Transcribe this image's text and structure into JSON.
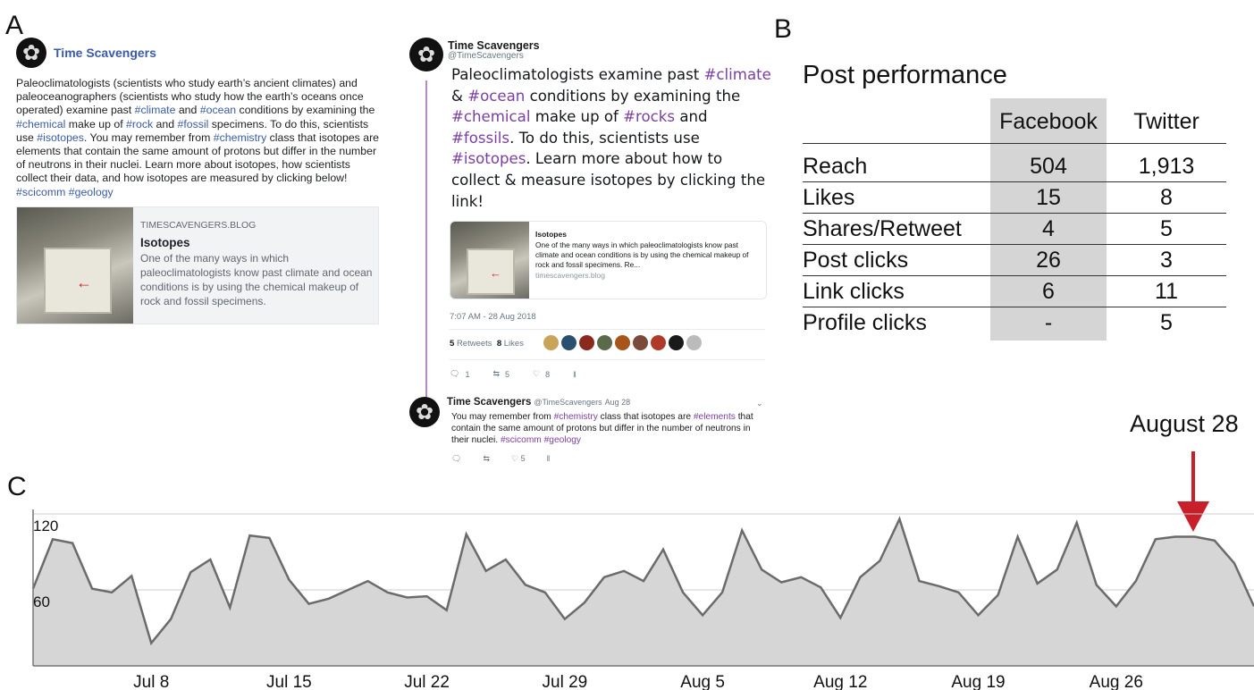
{
  "panel_labels": {
    "a": "A",
    "b": "B",
    "c": "C"
  },
  "facebook_post": {
    "page_name": "Time Scavengers",
    "text_parts": [
      {
        "t": "Paleoclimatologists (scientists who study earth’s ancient climates) and paleoceanographers (scientists who study how the earth’s oceans once operated) examine past ",
        "tag": false
      },
      {
        "t": "#climate",
        "tag": true
      },
      {
        "t": " and ",
        "tag": false
      },
      {
        "t": "#ocean",
        "tag": true
      },
      {
        "t": " conditions by examining the ",
        "tag": false
      },
      {
        "t": "#chemical",
        "tag": true
      },
      {
        "t": " make up of ",
        "tag": false
      },
      {
        "t": "#rock",
        "tag": true
      },
      {
        "t": " and ",
        "tag": false
      },
      {
        "t": "#fossil",
        "tag": true
      },
      {
        "t": " specimens. To do this, scientists use ",
        "tag": false
      },
      {
        "t": "#isotopes",
        "tag": true
      },
      {
        "t": ". You may remember from ",
        "tag": false
      },
      {
        "t": "#chemistry",
        "tag": true
      },
      {
        "t": " class that isotopes are elements that contain the same amount of protons but differ in the number of neutrons in their nuclei. Learn more about isotopes, how scientists collect their data, and how isotopes are measured by clicking below! ",
        "tag": false
      },
      {
        "t": "#scicomm",
        "tag": true
      },
      {
        "t": " ",
        "tag": false
      },
      {
        "t": "#geology",
        "tag": true
      }
    ],
    "link_card": {
      "domain": "TIMESCAVENGERS.BLOG",
      "title": "Isotopes",
      "description": "One of the many ways in which paleoclimatologists know past climate and ocean conditions is by using the chemical makeup of rock and fossil specimens."
    }
  },
  "tweet": {
    "name": "Time Scavengers",
    "handle": "@TimeScavengers",
    "text_parts": [
      {
        "t": "Paleoclimatologists examine past ",
        "tag": false
      },
      {
        "t": "#climate",
        "tag": true
      },
      {
        "t": " & ",
        "tag": false
      },
      {
        "t": "#ocean",
        "tag": true
      },
      {
        "t": " conditions by examining the ",
        "tag": false
      },
      {
        "t": "#chemical",
        "tag": true
      },
      {
        "t": " make up of ",
        "tag": false
      },
      {
        "t": "#rocks",
        "tag": true
      },
      {
        "t": " and ",
        "tag": false
      },
      {
        "t": "#fossils",
        "tag": true
      },
      {
        "t": ". To do this, scientists use ",
        "tag": false
      },
      {
        "t": "#isotopes",
        "tag": true
      },
      {
        "t": ". Learn more about how to collect & measure isotopes by clicking the link!",
        "tag": false
      }
    ],
    "card": {
      "title": "Isotopes",
      "description": "One of the many ways in which paleoclimatologists know past climate and ocean conditions is by using the chemical makeup of rock and fossil specimens. Re...",
      "domain": "timescavengers.blog"
    },
    "timestamp": "7:07 AM - 28 Aug 2018",
    "retweets_count": "5",
    "retweets_label": "Retweets",
    "likes_count": "8",
    "likes_label": "Likes",
    "liker_colors": [
      "#c9a35a",
      "#2b4f6e",
      "#8a2a1f",
      "#5a6a4a",
      "#a8551c",
      "#7a4a3a",
      "#b03a2a",
      "#1a1a1a",
      "#bbbbbb"
    ],
    "actions": {
      "reply": "1",
      "retweet": "5",
      "like": "8"
    },
    "icons": {
      "reply": "reply-icon",
      "retweet": "retweet-icon",
      "like": "heart-icon",
      "analytics": "analytics-icon"
    },
    "reply_tweet": {
      "name": "Time Scavengers",
      "handle": "@TimeScavengers",
      "date": "Aug 28",
      "text_parts": [
        {
          "t": "You may remember from ",
          "tag": false
        },
        {
          "t": "#chemistry",
          "tag": true
        },
        {
          "t": " class that isotopes are ",
          "tag": false
        },
        {
          "t": "#elements",
          "tag": true
        },
        {
          "t": " that contain the same amount of protons but differ in the number of neutrons in their nuclei. ",
          "tag": false
        },
        {
          "t": "#scicomm",
          "tag": true
        },
        {
          "t": " ",
          "tag": false
        },
        {
          "t": "#geology",
          "tag": true
        }
      ],
      "actions": {
        "like": "5"
      }
    }
  },
  "performance_table": {
    "title": "Post performance",
    "columns": [
      "",
      "Facebook",
      "Twitter"
    ],
    "rows": [
      [
        "Reach",
        "504",
        "1,913"
      ],
      [
        "Likes",
        "15",
        "8"
      ],
      [
        "Shares/Retweet",
        "4",
        "5"
      ],
      [
        "Post clicks",
        "26",
        "3"
      ],
      [
        "Link clicks",
        "6",
        "11"
      ],
      [
        "Profile clicks",
        "-",
        "5"
      ]
    ],
    "highlight_color": "#d5d5d5"
  },
  "annotation": {
    "label": "August 28",
    "arrow_color": "#c8202a"
  },
  "chart_data": {
    "type": "area",
    "title": "",
    "xlabel": "",
    "ylabel": "",
    "ylim": [
      0,
      120
    ],
    "yticks": [
      60,
      120
    ],
    "grid": true,
    "x": [
      "Jul 2",
      "Jul 3",
      "Jul 4",
      "Jul 5",
      "Jul 6",
      "Jul 7",
      "Jul 8",
      "Jul 9",
      "Jul 10",
      "Jul 11",
      "Jul 12",
      "Jul 13",
      "Jul 14",
      "Jul 15",
      "Jul 16",
      "Jul 17",
      "Jul 18",
      "Jul 19",
      "Jul 20",
      "Jul 21",
      "Jul 22",
      "Jul 23",
      "Jul 24",
      "Jul 25",
      "Jul 26",
      "Jul 27",
      "Jul 28",
      "Jul 29",
      "Jul 30",
      "Jul 31",
      "Aug 1",
      "Aug 2",
      "Aug 3",
      "Aug 4",
      "Aug 5",
      "Aug 6",
      "Aug 7",
      "Aug 8",
      "Aug 9",
      "Aug 10",
      "Aug 11",
      "Aug 12",
      "Aug 13",
      "Aug 14",
      "Aug 15",
      "Aug 16",
      "Aug 17",
      "Aug 18",
      "Aug 19",
      "Aug 20",
      "Aug 21",
      "Aug 22",
      "Aug 23",
      "Aug 24",
      "Aug 25",
      "Aug 26",
      "Aug 27",
      "Aug 28",
      "Aug 29",
      "Aug 30",
      "Aug 31",
      "Sep 1"
    ],
    "xtick_labels": [
      "Jul 8",
      "Jul 15",
      "Jul 22",
      "Jul 29",
      "Aug 5",
      "Aug 12",
      "Aug 19",
      "Aug 26"
    ],
    "xtick_index": [
      6,
      13,
      20,
      27,
      34,
      41,
      48,
      55
    ],
    "series": [
      {
        "values": [
          61,
          100,
          97,
          61,
          58,
          71,
          18,
          37,
          74,
          84,
          46,
          103,
          101,
          68,
          49,
          53,
          60,
          67,
          58,
          54,
          55,
          44,
          104,
          75,
          84,
          64,
          58,
          37,
          50,
          70,
          75,
          67,
          92,
          58,
          40,
          58,
          107,
          76,
          66,
          70,
          62,
          38,
          70,
          83,
          116,
          67,
          63,
          58,
          40,
          56,
          102,
          65,
          76,
          113,
          64,
          47,
          67,
          100,
          102,
          102,
          99,
          81,
          47
        ],
        "color": "#6b6b6b",
        "fill": "#d6d6d6"
      }
    ]
  }
}
